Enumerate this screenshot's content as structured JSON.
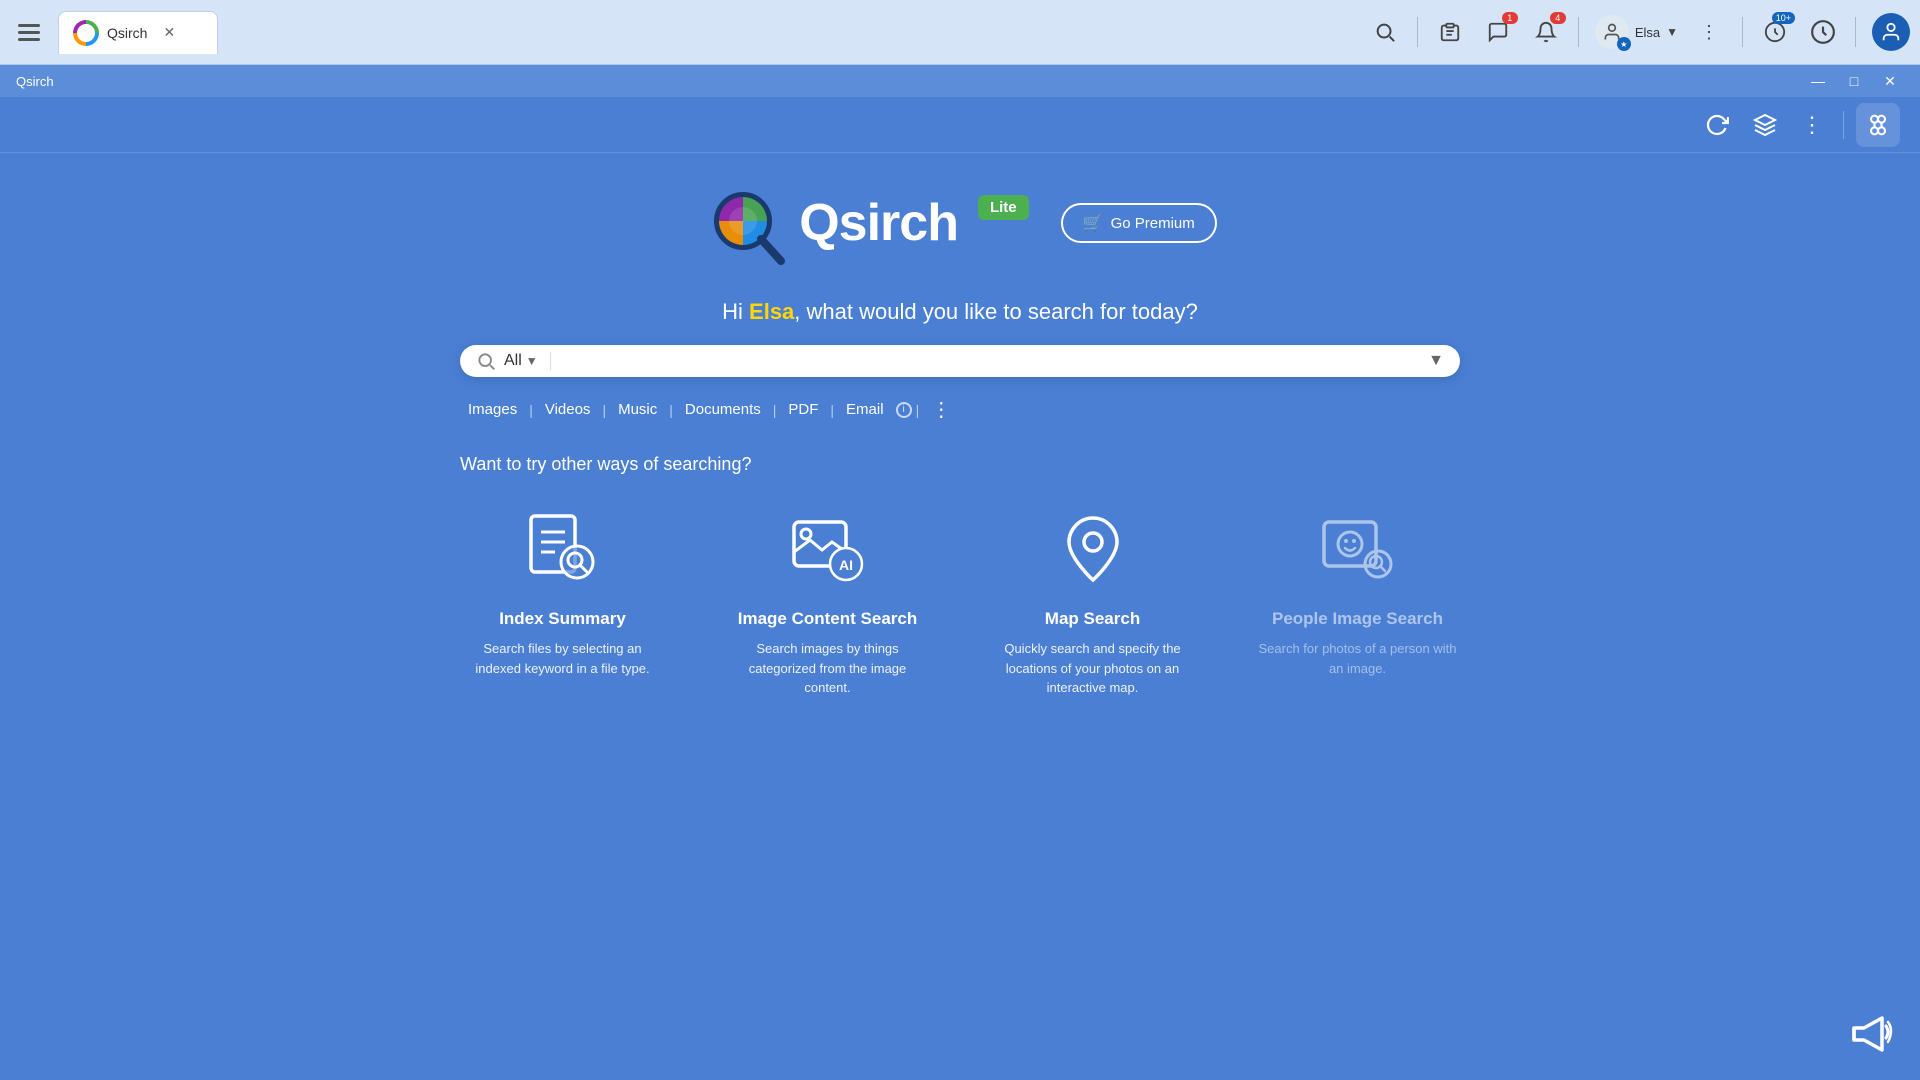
{
  "titleBar": {
    "appName": "Qsirch",
    "tabTitle": "Qsirch",
    "closeBtn": "✕"
  },
  "windowBar": {
    "title": "Qsirch",
    "minimizeBtn": "—",
    "maximizeBtn": "□",
    "closeBtn": "✕"
  },
  "topBar": {
    "notifications": {
      "messageCount": "1",
      "bellCount": "4",
      "extensionsCount": "10+"
    },
    "user": {
      "name": "Elsa"
    }
  },
  "greeting": {
    "prefix": "Hi ",
    "username": "Elsa",
    "suffix": ", what would you like to search for today?"
  },
  "search": {
    "filter": "All",
    "placeholder": ""
  },
  "filterTabs": [
    {
      "label": "Images",
      "separator": true
    },
    {
      "label": "Videos",
      "separator": true
    },
    {
      "label": "Music",
      "separator": true
    },
    {
      "label": "Documents",
      "separator": true
    },
    {
      "label": "PDF",
      "separator": true
    },
    {
      "label": "Email",
      "hasInfo": true,
      "separator": true
    }
  ],
  "logo": {
    "name": "Qsirch",
    "badge": "Lite",
    "premiumBtn": "Go Premium"
  },
  "trySection": {
    "heading": "Want to try other ways of searching?",
    "cards": [
      {
        "id": "index-summary",
        "title": "Index Summary",
        "description": "Search files by selecting an indexed keyword in a file type.",
        "disabled": false
      },
      {
        "id": "image-content-search",
        "title": "Image Content Search",
        "description": "Search images by things categorized from the image content.",
        "disabled": false
      },
      {
        "id": "map-search",
        "title": "Map Search",
        "description": "Quickly search and specify the locations of your photos on an interactive map.",
        "disabled": false
      },
      {
        "id": "people-image-search",
        "title": "People Image Search",
        "description": "Search for photos of a person with an image.",
        "disabled": true
      }
    ]
  }
}
